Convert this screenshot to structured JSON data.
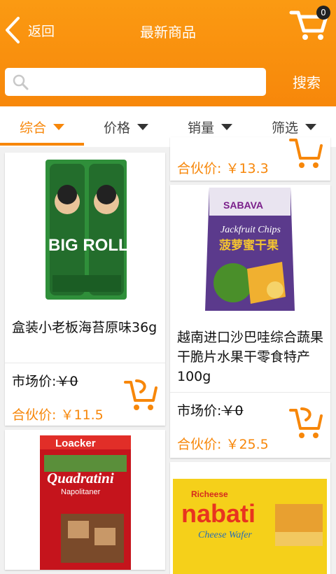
{
  "header": {
    "back_label": "返回",
    "title": "最新商品",
    "cart_count": "0",
    "back_icon": "chevron-left-icon",
    "cart_icon": "shopping-cart-icon"
  },
  "search": {
    "placeholder": "",
    "value": "",
    "button_label": "搜索",
    "icon": "search-icon"
  },
  "tabs": [
    {
      "label": "综合",
      "active": true
    },
    {
      "label": "价格",
      "active": false
    },
    {
      "label": "销量",
      "active": false
    },
    {
      "label": "筛选",
      "active": false
    }
  ],
  "colors": {
    "accent": "#f7870a",
    "header": "#fb9a12",
    "background": "#f1f1f1"
  },
  "products": [
    {
      "name": "盒装小老板海苔原味36g",
      "market_label": "市场价:",
      "market_price": "￥0",
      "partner_label": "合伙价:",
      "partner_price": "￥11.5",
      "image": "Big Roll seaweed box"
    },
    {
      "partner_label": "合伙价:",
      "partner_price": "￥13.3"
    },
    {
      "name": "越南进口沙巴哇综合蔬果干脆片水果干零食特产100g",
      "market_label": "市场价:",
      "market_price": "￥0",
      "partner_label": "合伙价:",
      "partner_price": "￥25.5",
      "image": "Sabava jackfruit chips bag"
    },
    {
      "image": "Loacker Quadratini wafers bag",
      "img_texts": [
        "Loacker",
        "Quadratini",
        "Napolitaner"
      ]
    },
    {
      "image": "Richeese Nabati cheese wafer",
      "img_texts": [
        "Richeese",
        "nabati",
        "Cheese Wafer"
      ]
    }
  ],
  "img_texts": {
    "big_roll": "BIG ROLL",
    "sabava": "SABAVA",
    "jackfruit": "Jackfruit Chips",
    "jackfruit_cn": "菠萝蜜干果"
  }
}
